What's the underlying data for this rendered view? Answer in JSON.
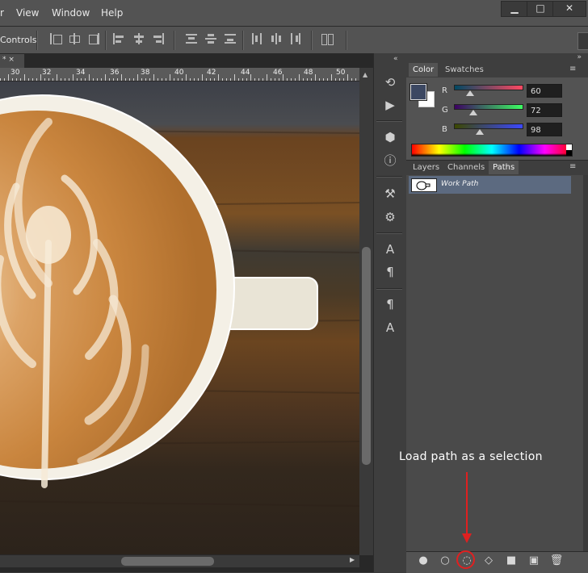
{
  "menubar": {
    "items": [
      "r",
      "View",
      "Window",
      "Help"
    ],
    "min_label": "▁",
    "max_label": "□",
    "close_label": "✕"
  },
  "options_bar": {
    "label": "Controls"
  },
  "document": {
    "tab_label": "*  ×",
    "ruler_ticks": [
      "30",
      "32",
      "34",
      "36",
      "38",
      "40",
      "42",
      "44",
      "46",
      "48",
      "50"
    ]
  },
  "color_panel": {
    "tabs": [
      "Color",
      "Swatches"
    ],
    "foreground_hex": "#3c4862",
    "background_hex": "#ffffff",
    "channels": [
      {
        "label": "R",
        "value": "60"
      },
      {
        "label": "G",
        "value": "72"
      },
      {
        "label": "B",
        "value": "98"
      }
    ]
  },
  "paths_panel": {
    "tabs": [
      "Layers",
      "Channels",
      "Paths"
    ],
    "paths": [
      {
        "name": "Work Path"
      }
    ]
  },
  "annotation": {
    "text": "Load path as a selection",
    "color": "#e02020"
  },
  "icons": {
    "fill_path": "●",
    "stroke_path": "○",
    "load_selection": "◌",
    "work_path_from_selection": "◇",
    "add_mask": "■",
    "new_path": "▣",
    "delete": "🗑"
  }
}
